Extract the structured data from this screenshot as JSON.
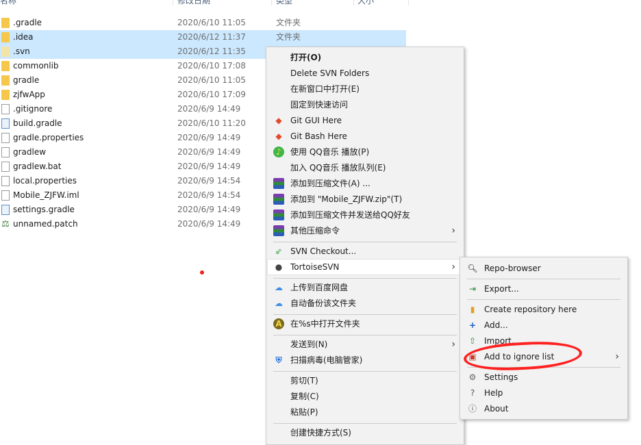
{
  "columns": {
    "name": "名称",
    "modified": "修改日期",
    "type": "类型",
    "size": "大小"
  },
  "files": [
    {
      "name": ".gradle",
      "date": "2020/6/10 11:05",
      "type": "文件夹",
      "icon": "folder-icon",
      "selected": false
    },
    {
      "name": ".idea",
      "date": "2020/6/12 11:37",
      "type": "文件夹",
      "icon": "folder-icon",
      "selected": true
    },
    {
      "name": ".svn",
      "date": "2020/6/12 11:35",
      "type": "",
      "icon": "folder-icon",
      "selected": true
    },
    {
      "name": "commonlib",
      "date": "2020/6/10 17:08",
      "type": "",
      "icon": "folder-icon",
      "selected": false
    },
    {
      "name": "gradle",
      "date": "2020/6/10 11:05",
      "type": "",
      "icon": "folder-icon",
      "selected": false
    },
    {
      "name": "zjfwApp",
      "date": "2020/6/10 17:09",
      "type": "",
      "icon": "folder-icon",
      "selected": false
    },
    {
      "name": ".gitignore",
      "date": "2020/6/9 14:49",
      "type": "",
      "icon": "file-icon",
      "selected": false
    },
    {
      "name": "build.gradle",
      "date": "2020/6/10 11:20",
      "type": "",
      "icon": "file-icon",
      "selected": false
    },
    {
      "name": "gradle.properties",
      "date": "2020/6/9 14:49",
      "type": "",
      "icon": "file-icon",
      "selected": false
    },
    {
      "name": "gradlew",
      "date": "2020/6/9 14:49",
      "type": "",
      "icon": "file-icon",
      "selected": false
    },
    {
      "name": "gradlew.bat",
      "date": "2020/6/9 14:49",
      "type": "",
      "icon": "file-icon",
      "selected": false
    },
    {
      "name": "local.properties",
      "date": "2020/6/9 14:54",
      "type": "",
      "icon": "file-icon",
      "selected": false
    },
    {
      "name": "Mobile_ZJFW.iml",
      "date": "2020/6/9 14:54",
      "type": "",
      "icon": "file-icon",
      "selected": false
    },
    {
      "name": "settings.gradle",
      "date": "2020/6/9 14:49",
      "type": "",
      "icon": "file-icon",
      "selected": false
    },
    {
      "name": "unnamed.patch",
      "date": "2020/6/9 14:49",
      "type": "",
      "icon": "patch-icon",
      "selected": false
    }
  ],
  "context_menu": {
    "open": "打开(O)",
    "delete_svn": "Delete SVN Folders",
    "open_new_window": "在新窗口中打开(E)",
    "pin_quick_access": "固定到快速访问",
    "git_gui": "Git GUI Here",
    "git_bash": "Git Bash Here",
    "qq_play": "使用 QQ音乐 播放(P)",
    "qq_queue": "加入 QQ音乐 播放队列(E)",
    "add_archive": "添加到压缩文件(A) ...",
    "add_zip": "添加到 \"Mobile_ZJFW.zip\"(T)",
    "add_zip_qq": "添加到压缩文件并发送给QQ好友",
    "other_compress": "其他压缩命令",
    "svn_checkout": "SVN Checkout...",
    "tortoisesvn": "TortoiseSVN",
    "upload_baidu": "上传到百度网盘",
    "auto_backup": "自动备份该文件夹",
    "open_in": "在%s中打开文件夹",
    "send_to": "发送到(N)",
    "scan_virus": "扫描病毒(电脑管家)",
    "cut": "剪切(T)",
    "copy": "复制(C)",
    "paste": "粘贴(P)",
    "create_shortcut": "创建快捷方式(S)"
  },
  "submenu": {
    "repo_browser": "Repo-browser",
    "export": "Export...",
    "create_repo": "Create repository here",
    "add": "Add...",
    "import": "Import...",
    "add_ignore": "Add to ignore list",
    "settings": "Settings",
    "help": "Help",
    "about": "About"
  },
  "colors": {
    "selection": "#cce8ff",
    "annotation": "#ff2020",
    "folder": "#f5c84c"
  }
}
